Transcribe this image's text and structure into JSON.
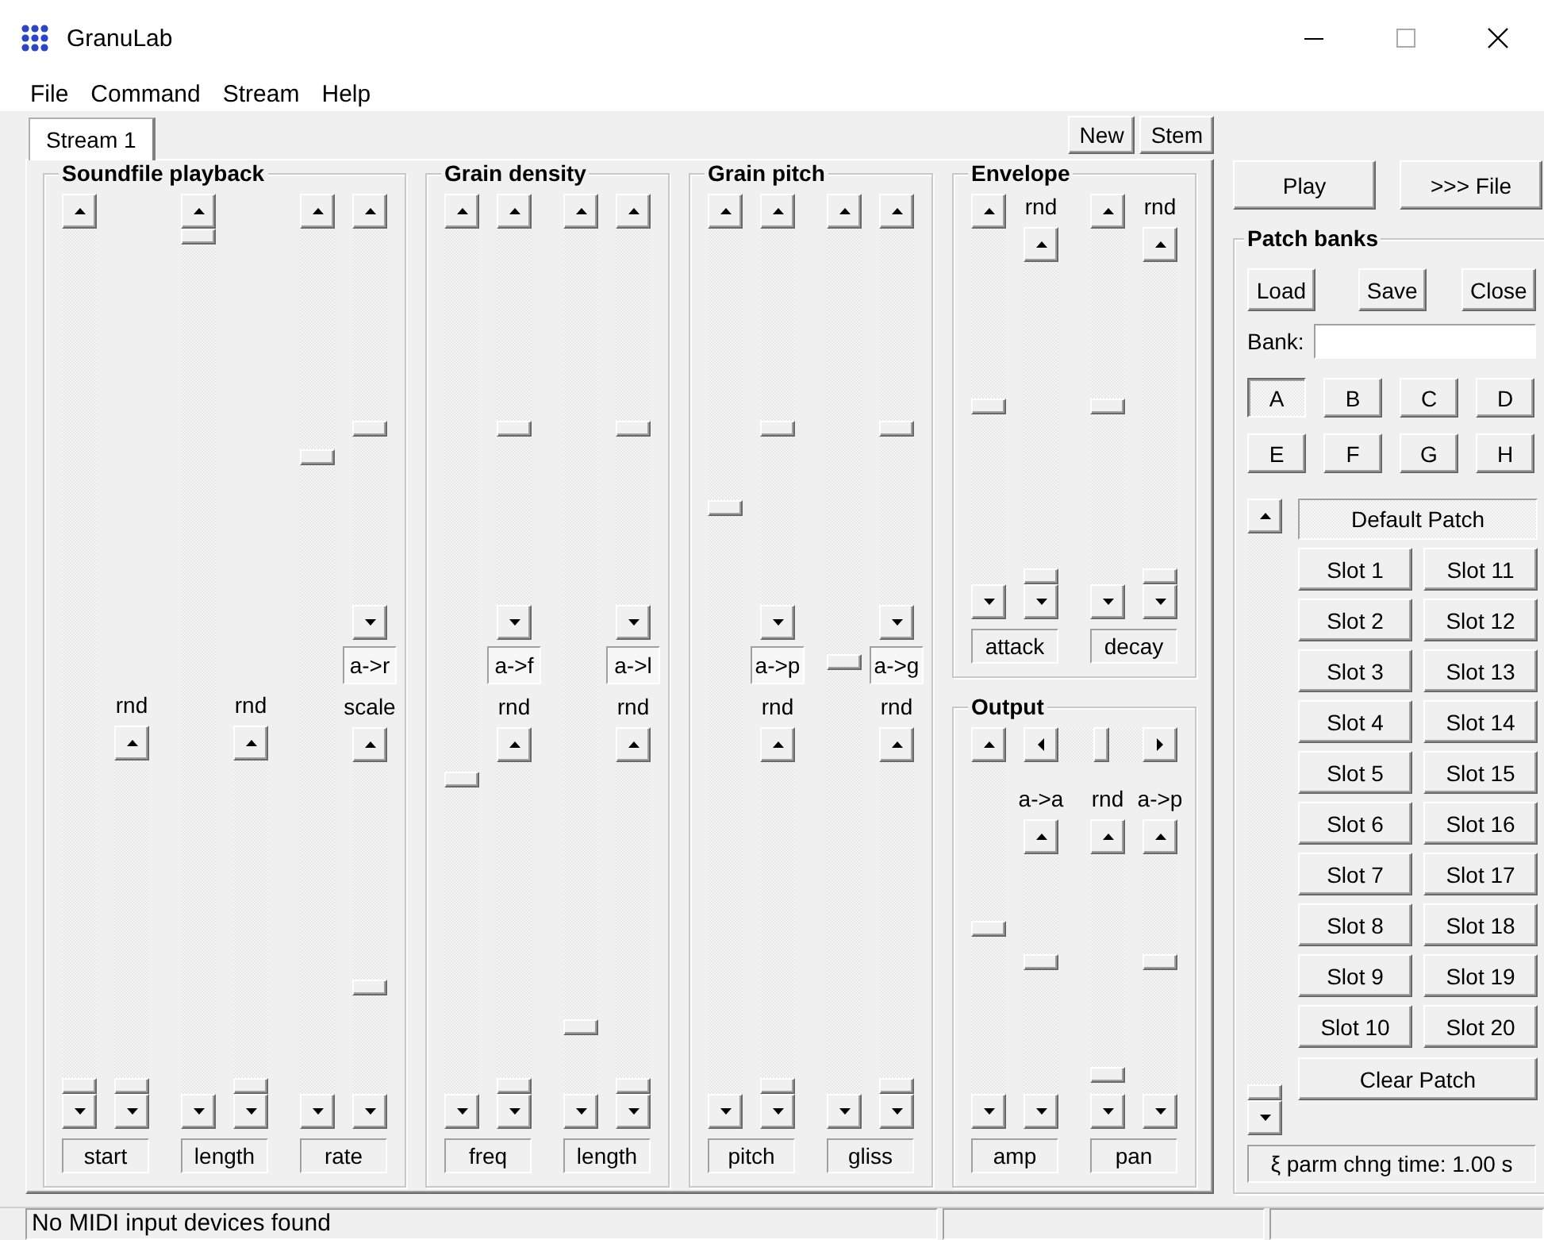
{
  "window": {
    "title": "GranuLab"
  },
  "menu": [
    "File",
    "Command",
    "Stream",
    "Help"
  ],
  "tabs": [
    {
      "label": "Stream 1",
      "selected": true
    }
  ],
  "stream_buttons": [
    "New",
    "Stem"
  ],
  "groups": [
    {
      "title": "Soundfile playback",
      "params": [
        {
          "name": "start",
          "columns": [
            {
              "kind": "full",
              "level": 0.0
            },
            {
              "kind": "lower",
              "label": "rnd",
              "level": 0.0
            }
          ]
        },
        {
          "name": "length",
          "columns": [
            {
              "kind": "full",
              "level": 1.0
            },
            {
              "kind": "lower",
              "label": "rnd",
              "level": 0.0
            }
          ]
        },
        {
          "name": "rate",
          "columns": [
            {
              "kind": "full",
              "level": 0.74
            },
            {
              "kind": "split",
              "upper": {
                "level": 0.47
              },
              "value": "a->r",
              "label": "scale",
              "level": 0.31
            }
          ]
        }
      ]
    },
    {
      "title": "Grain density",
      "params": [
        {
          "name": "freq",
          "columns": [
            {
              "kind": "full",
              "level": 0.36
            },
            {
              "kind": "split",
              "upper": {
                "level": 0.47
              },
              "value": "a->f",
              "label": "rnd",
              "level": 0.0
            }
          ]
        },
        {
          "name": "length",
          "columns": [
            {
              "kind": "full",
              "level": 0.07
            },
            {
              "kind": "split",
              "upper": {
                "level": 0.47
              },
              "value": "a->l",
              "label": "rnd",
              "level": 0.0
            }
          ]
        }
      ]
    },
    {
      "title": "Grain pitch",
      "params": [
        {
          "name": "pitch",
          "columns": [
            {
              "kind": "full",
              "level": 0.68
            },
            {
              "kind": "split",
              "upper": {
                "level": 0.47
              },
              "value": "a->p",
              "label": "rnd",
              "level": 0.0
            }
          ]
        },
        {
          "name": "gliss",
          "columns": [
            {
              "kind": "full",
              "level": 0.5
            },
            {
              "kind": "split",
              "upper": {
                "level": 0.47
              },
              "value": "a->g",
              "label": "rnd",
              "level": 0.0
            }
          ]
        }
      ]
    }
  ],
  "side_groups": [
    {
      "title": "Envelope",
      "params": [
        {
          "name": "attack",
          "columns": [
            {
              "kind": "full",
              "level": 0.5
            },
            {
              "kind": "labeled",
              "label": "rnd",
              "level": 0.0
            }
          ]
        },
        {
          "name": "decay",
          "columns": [
            {
              "kind": "full",
              "level": 0.5
            },
            {
              "kind": "labeled",
              "label": "rnd",
              "level": 0.0
            }
          ]
        }
      ]
    },
    {
      "title": "Output",
      "h_slider": {
        "level": 0.5
      },
      "params": [
        {
          "name": "amp",
          "columns": [
            {
              "kind": "full",
              "level": 0.5
            },
            {
              "kind": "labeled",
              "label": "a->a",
              "level": 0.55
            }
          ]
        },
        {
          "name": "pan",
          "columns": [
            {
              "kind": "labeled",
              "label": "rnd",
              "level": 0.05
            },
            {
              "kind": "labeled",
              "label": "a->p",
              "level": 0.55
            }
          ]
        }
      ]
    }
  ],
  "transport_buttons": [
    "Play",
    ">>> File"
  ],
  "patch_banks": {
    "title": "Patch banks",
    "buttons": [
      "Load",
      "Save",
      "Close"
    ],
    "bank_label": "Bank:",
    "banks": [
      {
        "label": "A",
        "selected": true
      },
      {
        "label": "B",
        "selected": false
      },
      {
        "label": "C",
        "selected": false
      },
      {
        "label": "D",
        "selected": false
      },
      {
        "label": "E",
        "selected": false
      },
      {
        "label": "F",
        "selected": false
      },
      {
        "label": "G",
        "selected": false
      },
      {
        "label": "H",
        "selected": false
      }
    ],
    "list_scroll": {
      "level": 0.0
    },
    "current_patch": "Default Patch",
    "slots": [
      "Slot 1",
      "Slot 2",
      "Slot 3",
      "Slot 4",
      "Slot 5",
      "Slot 6",
      "Slot 7",
      "Slot 8",
      "Slot 9",
      "Slot 10",
      "Slot 11",
      "Slot 12",
      "Slot 13",
      "Slot 14",
      "Slot 15",
      "Slot 16",
      "Slot 17",
      "Slot 18",
      "Slot 19",
      "Slot 20"
    ],
    "clear_button": "Clear Patch",
    "parm_time": "ξ parm chng time: 1.00 s"
  },
  "status_bar": [
    "No MIDI input devices found"
  ]
}
